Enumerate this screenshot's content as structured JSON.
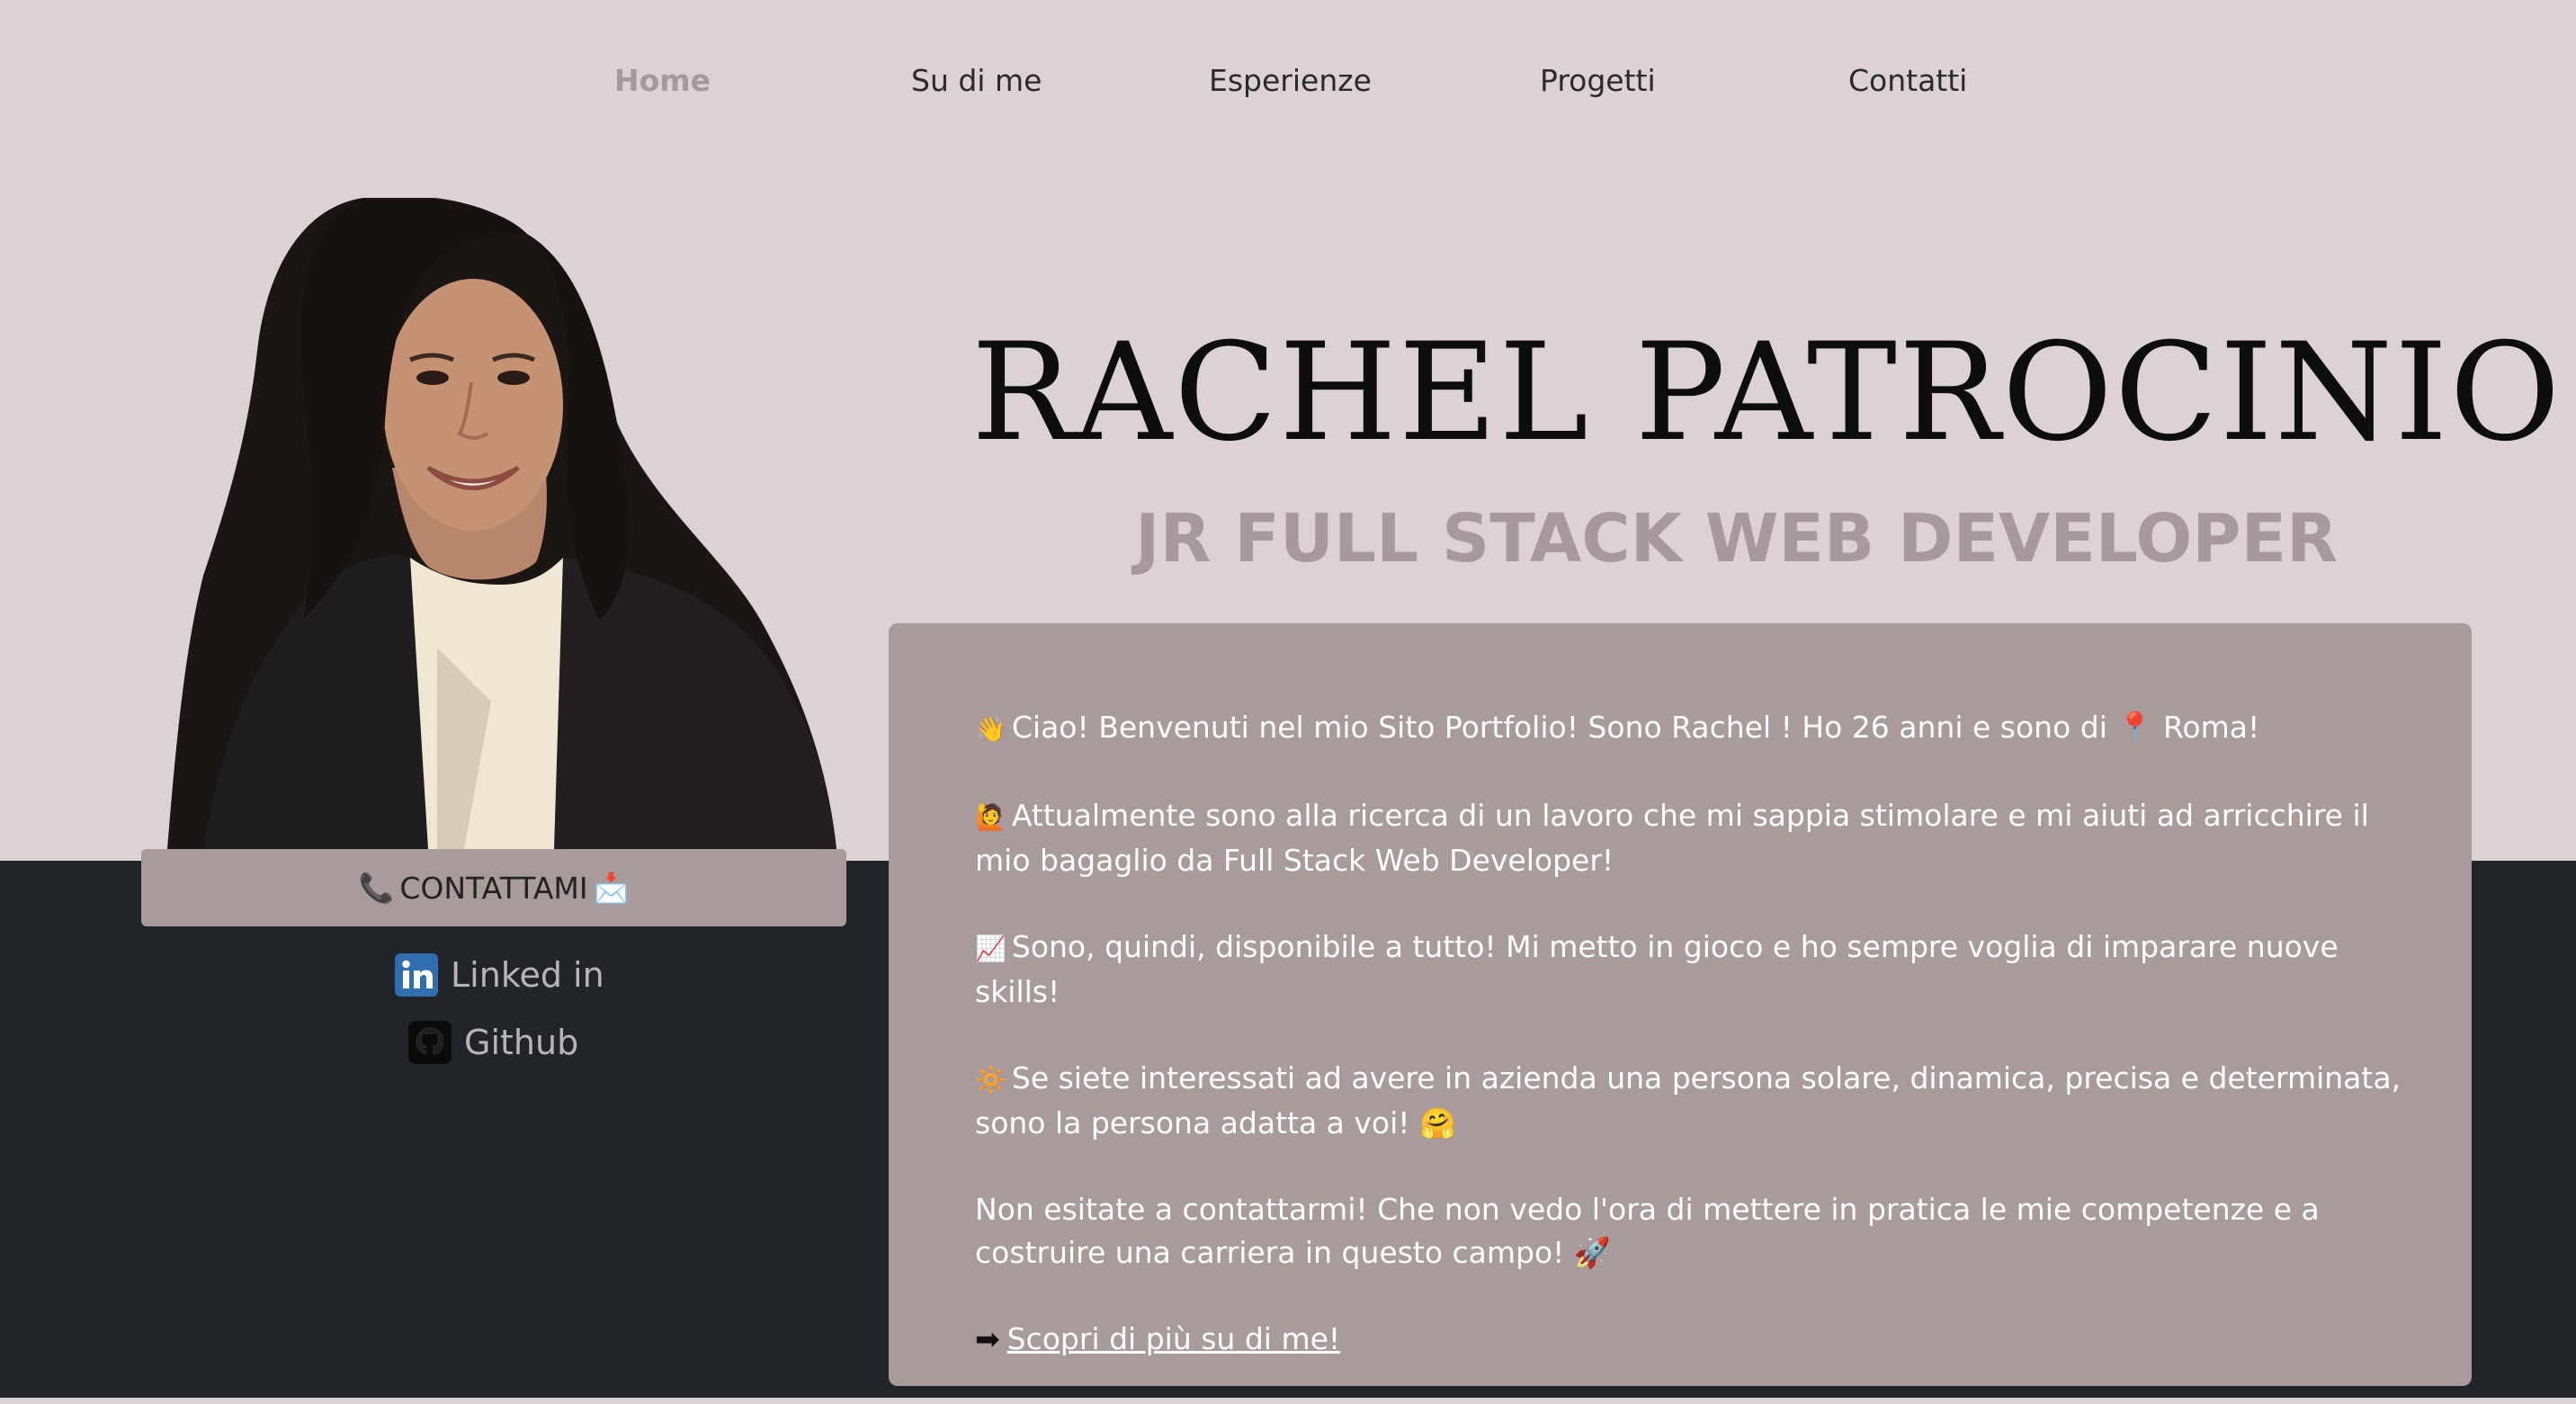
{
  "nav": {
    "items": [
      {
        "label": "Home",
        "active": true
      },
      {
        "label": "Su di me",
        "active": false
      },
      {
        "label": "Esperienze",
        "active": false
      },
      {
        "label": "Progetti",
        "active": false
      },
      {
        "label": "Contatti",
        "active": false
      }
    ]
  },
  "hero": {
    "name": "RACHEL PATROCINIO",
    "subtitle": "JR FULL STACK WEB DEVELOPER"
  },
  "profile": {
    "contact_button": {
      "icon_left": "📞",
      "label": "CONTATTAMI",
      "icon_right": "📩"
    },
    "social": [
      {
        "label": "Linked in",
        "icon": "linkedin-icon"
      },
      {
        "label": "Github",
        "icon": "github-icon"
      }
    ]
  },
  "about": {
    "paragraphs": [
      {
        "emoji": "👋",
        "text": "Ciao! Benvenuti nel mio Sito Portfolio! Sono Rachel ! Ho 26 anni e sono di 📍 Roma!"
      },
      {
        "emoji": "🙋",
        "text": "Attualmente sono alla ricerca di un lavoro che mi sappia stimolare e mi aiuti ad arricchire il mio bagaglio da Full Stack Web Developer!"
      },
      {
        "emoji": "📈",
        "text": "Sono, quindi, disponibile a tutto! Mi metto in gioco e ho sempre voglia di imparare nuove skills!"
      },
      {
        "emoji": "🔆",
        "text": "Se siete interessati ad avere in azienda una persona solare, dinamica, precisa e determinata, sono la persona adatta a voi! 🤗"
      },
      {
        "emoji": "",
        "text": "Non esitate a contattarmi! Che non vedo l'ora di mettere in pratica le mie competenze e a costruire una carriera in questo campo! 🚀"
      }
    ],
    "link": {
      "arrow": "➡",
      "label": "Scopri di più su di me!"
    }
  },
  "colors": {
    "page_bg": "#dcd1d4",
    "dark_band": "#212428",
    "card_bg": "#a99a9b",
    "accent_muted": "#a89a9c"
  }
}
